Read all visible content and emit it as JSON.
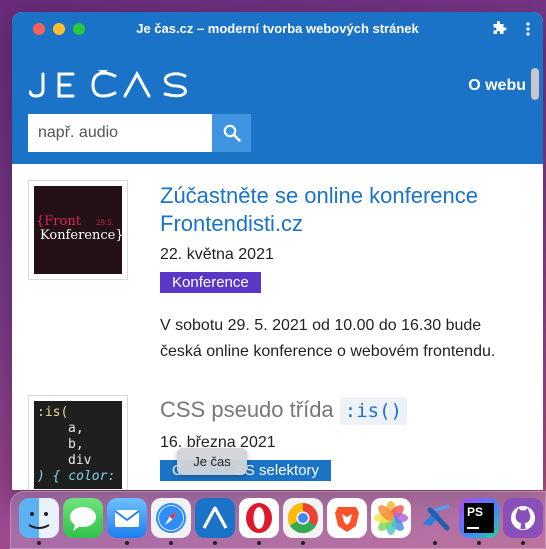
{
  "window": {
    "title": "Je čas.cz – moderní tvorba webových stránek"
  },
  "header": {
    "logo_text": "JE ČAS",
    "nav_link": "O webu",
    "search": {
      "placeholder": "např. audio",
      "value": ""
    }
  },
  "articles": [
    {
      "title": "Zúčastněte se online konference Frontendisti.cz",
      "date": "22. května 2021",
      "tag": "Konference",
      "excerpt": "V sobotu 29. 5. 2021 od 10.00 do 16.30 bude česká online konference o webovém frontendu.",
      "thumb_text": {
        "line1": "{Front",
        "badge": "29.5.",
        "line2": "Konference}"
      }
    },
    {
      "title_prefix": "CSS pseudo třída",
      "title_code": ":is()",
      "date": "16. března 2021",
      "tag": "CSS selektory",
      "tag_visible": "SS selektory",
      "tag_start": "C",
      "thumb_code": [
        ":is(",
        "a,",
        "b,",
        "div",
        ") { color:"
      ]
    }
  ],
  "tooltip": "Je čas",
  "dock": {
    "items": [
      "finder-icon",
      "messages-icon",
      "mail-icon",
      "safari-icon",
      "je-cas-icon",
      "opera-icon",
      "chrome-icon",
      "brave-icon",
      "photos-icon",
      "vscode-icon",
      "phpstorm-icon",
      "github-icon"
    ],
    "phpstorm_label": "PS"
  },
  "colors": {
    "brand_blue": "#1a73c7",
    "tag_purple": "#5b37c8",
    "search_button": "#3f95df"
  }
}
